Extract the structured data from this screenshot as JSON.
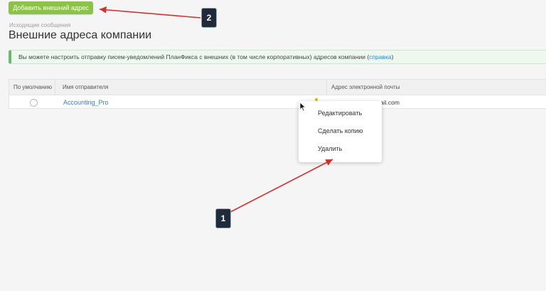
{
  "toolbar": {
    "add_button_label": "Добавить внешний адрес"
  },
  "breadcrumb": "Исходящие сообщения",
  "page_title": "Внешние адреса компании",
  "info": {
    "text": "Вы можете настроить отправку писем-уведомлений ПланФикса с внешних (в том числе корпоративных) адресов компании (",
    "link": "справка",
    "suffix": ")"
  },
  "table": {
    "headers": [
      "По умолчанию",
      "Имя отправителя",
      "Адрес электронной почты"
    ],
    "rows": [
      {
        "sender": "Accounting_Pro",
        "email": "ail.com"
      }
    ]
  },
  "context_menu": {
    "items": [
      "Редактировать",
      "Сделать копию",
      "Удалить"
    ]
  },
  "annotations": {
    "badge1": "1",
    "badge2": "2",
    "arrow_color": "#d32f2f"
  },
  "colors": {
    "accent_green": "#8bc34a",
    "link_blue": "#3b78c6"
  }
}
